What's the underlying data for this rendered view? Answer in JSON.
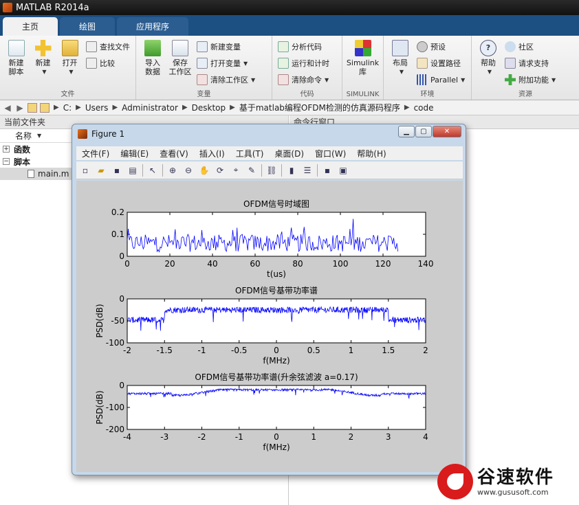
{
  "window": {
    "title": "MATLAB R2014a"
  },
  "ribbon": {
    "tabs": [
      "主页",
      "绘图",
      "应用程序"
    ],
    "groups": {
      "file": {
        "label": "文件",
        "new_script": "新建\n脚本",
        "new": "新建",
        "open": "打开",
        "find_files": "查找文件",
        "compare": "比较"
      },
      "variable": {
        "label": "变量",
        "import": "导入\n数据",
        "save_workspace": "保存\n工作区",
        "new_variable": "新建变量",
        "open_variable": "打开变量",
        "clear_workspace": "清除工作区"
      },
      "code": {
        "label": "代码",
        "analyze": "分析代码",
        "run_time": "运行和计时",
        "clear_commands": "清除命令"
      },
      "simulink": {
        "label": "SIMULINK",
        "library": "Simulink\n库"
      },
      "environment": {
        "label": "环境",
        "layout": "布局",
        "preferences": "预设",
        "set_path": "设置路径",
        "parallel": "Parallel"
      },
      "resources": {
        "label": "资源",
        "help": "帮助",
        "community": "社区",
        "request_support": "请求支持",
        "addons": "附加功能"
      }
    }
  },
  "address": {
    "crumbs": [
      "C:",
      "Users",
      "Administrator",
      "Desktop",
      "基于matlab编程OFDM检测的仿真源码程序",
      "code"
    ]
  },
  "current_folder": {
    "title": "当前文件夹",
    "column": "名称",
    "items": [
      {
        "label": "函数",
        "type": "folder"
      },
      {
        "label": "脚本",
        "type": "folder"
      },
      {
        "label": "main.m",
        "type": "file"
      }
    ]
  },
  "command_window": {
    "title": "命令行窗口"
  },
  "figure": {
    "title": "Figure 1",
    "menu": [
      "文件(F)",
      "编辑(E)",
      "查看(V)",
      "插入(I)",
      "工具(T)",
      "桌面(D)",
      "窗口(W)",
      "帮助(H)"
    ]
  },
  "chart_data": [
    {
      "type": "line",
      "title": "OFDM信号时域图",
      "xlabel": "t(us)",
      "ylabel": "",
      "xlim": [
        0,
        140
      ],
      "ylim": [
        0,
        0.2
      ],
      "xticks": [
        0,
        20,
        40,
        60,
        80,
        100,
        120,
        140
      ],
      "yticks": [
        0,
        0.1,
        0.2
      ],
      "series": [
        {
          "color": "#0000ff",
          "x_range": [
            0,
            127
          ],
          "baseline": 0.06,
          "noise": 0.04,
          "peak": 0.14
        }
      ]
    },
    {
      "type": "line",
      "title": "OFDM信号基带功率谱",
      "xlabel": "f(MHz)",
      "ylabel": "PSD(dB)",
      "xlim": [
        -2,
        2
      ],
      "ylim": [
        -100,
        0
      ],
      "xticks": [
        -2,
        -1.5,
        -1,
        -0.5,
        0,
        0.5,
        1,
        1.5,
        2
      ],
      "yticks": [
        -100,
        -50,
        0
      ],
      "series": [
        {
          "color": "#0000ff",
          "passband": [
            -1.5,
            1.5
          ],
          "in_band_db": -25,
          "out_band_db": -48
        }
      ]
    },
    {
      "type": "line",
      "title": "OFDM信号基带功率谱(升余弦滤波 a=0.17)",
      "xlabel": "f(MHz)",
      "ylabel": "PSD(dB)",
      "xlim": [
        -4,
        4
      ],
      "ylim": [
        -200,
        0
      ],
      "xticks": [
        -4,
        -3,
        -2,
        -1,
        0,
        1,
        2,
        3,
        4
      ],
      "yticks": [
        -200,
        -100,
        0
      ],
      "series": [
        {
          "color": "#0000ff",
          "passband": [
            -1.5,
            1.5
          ],
          "in_band_db": -20,
          "out_band_db": -45
        }
      ]
    }
  ],
  "watermark": {
    "name": "谷速软件",
    "url": "www.gususoft.com"
  },
  "colors": {
    "ribbon_tab_bg": "#1c4f82",
    "plot_line": "#0000ff",
    "figure_frame": "#c6d8ea",
    "watermark_red": "#d91b1b"
  }
}
